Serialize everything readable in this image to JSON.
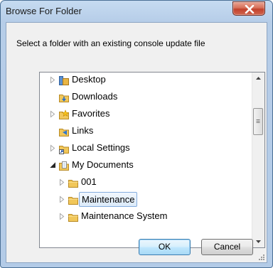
{
  "window": {
    "title": "Browse For Folder"
  },
  "dialog": {
    "instruction": "Select a folder with an existing console update file"
  },
  "tree": {
    "items": [
      {
        "label": "Desktop",
        "icon": "desktop-folder-icon",
        "expander": "collapsed",
        "selected": false
      },
      {
        "label": "Downloads",
        "icon": "downloads-folder-icon",
        "expander": "none",
        "selected": false
      },
      {
        "label": "Favorites",
        "icon": "favorites-folder-icon",
        "expander": "collapsed",
        "selected": false
      },
      {
        "label": "Links",
        "icon": "links-folder-icon",
        "expander": "none",
        "selected": false
      },
      {
        "label": "Local Settings",
        "icon": "shortcut-folder-icon",
        "expander": "collapsed",
        "selected": false
      },
      {
        "label": "My Documents",
        "icon": "documents-folder-icon",
        "expander": "expanded",
        "selected": false
      },
      {
        "label": "001",
        "icon": "folder-icon",
        "expander": "collapsed",
        "selected": false
      },
      {
        "label": "Maintenance",
        "icon": "folder-icon",
        "expander": "collapsed",
        "selected": true
      },
      {
        "label": "Maintenance System",
        "icon": "folder-icon",
        "expander": "collapsed",
        "selected": false
      }
    ]
  },
  "buttons": {
    "ok_label": "OK",
    "cancel_label": "Cancel"
  }
}
